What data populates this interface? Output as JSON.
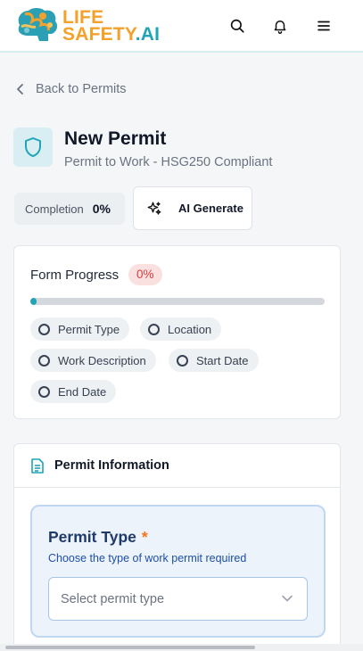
{
  "header": {
    "logo_line1": "LIFE",
    "logo_line2a": "SAFETY",
    "logo_line2b": ".AI",
    "icons": [
      "search-icon",
      "bell-icon",
      "menu-icon"
    ]
  },
  "nav": {
    "back_label": "Back to Permits"
  },
  "page": {
    "title": "New Permit",
    "subtitle": "Permit to Work - HSG250 Compliant",
    "icon": "shield-icon"
  },
  "completion": {
    "label": "Completion",
    "value": "0%"
  },
  "ai_button": {
    "label": "AI Generate",
    "icon": "sparkles-icon"
  },
  "form_progress": {
    "title": "Form Progress",
    "badge": "0%",
    "progress": 0.02,
    "items": [
      {
        "label": "Permit Type"
      },
      {
        "label": "Location"
      },
      {
        "label": "Work Description"
      },
      {
        "label": "Start Date"
      },
      {
        "label": "End Date"
      }
    ]
  },
  "permit_info": {
    "title": "Permit Information",
    "icon": "document-icon",
    "field": {
      "label": "Permit Type",
      "required_mark": "*",
      "help": "Choose the type of work permit required",
      "placeholder": "Select permit type"
    }
  },
  "colors": {
    "accent": "#1fa5b5",
    "brand_orange": "#f4a12b",
    "danger": "#dc3d3d",
    "required": "#f97316"
  }
}
